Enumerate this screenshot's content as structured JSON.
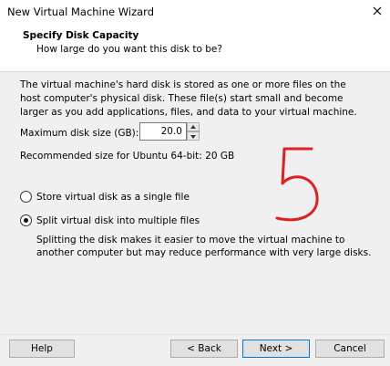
{
  "window": {
    "title": "New Virtual Machine Wizard"
  },
  "header": {
    "title": "Specify Disk Capacity",
    "subtitle": "How large do you want this disk to be?"
  },
  "content": {
    "description": "The virtual machine's hard disk is stored as one or more files on the host computer's physical disk. These file(s) start small and become larger as you add applications, files, and data to your virtual machine.",
    "disk_size_label": "Maximum disk size (GB):",
    "disk_size_value": "20.0",
    "recommended": "Recommended size for Ubuntu 64-bit: 20 GB",
    "options": [
      {
        "label": "Store virtual disk as a single file",
        "selected": false
      },
      {
        "label": "Split virtual disk into multiple files",
        "selected": true
      }
    ],
    "split_description": "Splitting the disk makes it easier to move the virtual machine to another computer but may reduce performance with very large disks."
  },
  "annotation": {
    "color": "#e02020"
  },
  "buttons": {
    "help": "Help",
    "back": "< Back",
    "next": "Next >",
    "cancel": "Cancel"
  }
}
